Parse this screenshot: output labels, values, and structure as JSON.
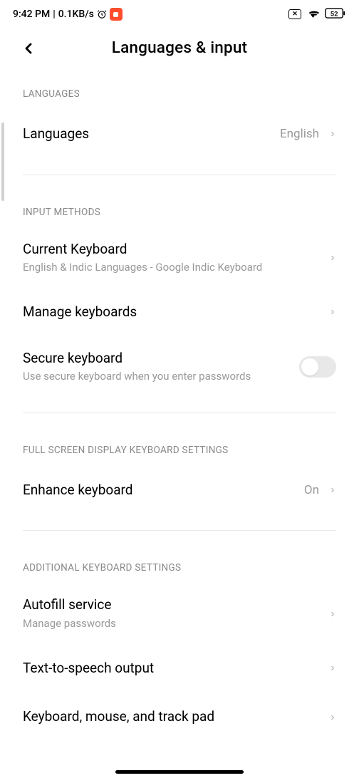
{
  "statusBar": {
    "time": "9:42 PM",
    "separator": "|",
    "dataRate": "0.1KB/s",
    "battery": "52"
  },
  "header": {
    "title": "Languages & input"
  },
  "sections": {
    "languages": {
      "header": "LANGUAGES",
      "items": {
        "languages": {
          "title": "Languages",
          "value": "English"
        }
      }
    },
    "inputMethods": {
      "header": "INPUT METHODS",
      "items": {
        "currentKeyboard": {
          "title": "Current Keyboard",
          "subtitle": "English & Indic Languages - Google Indic Keyboard"
        },
        "manageKeyboards": {
          "title": "Manage keyboards"
        },
        "secureKeyboard": {
          "title": "Secure keyboard",
          "subtitle": "Use secure keyboard when you enter passwords",
          "toggle": false
        }
      }
    },
    "fullscreen": {
      "header": "FULL SCREEN DISPLAY KEYBOARD SETTINGS",
      "items": {
        "enhanceKeyboard": {
          "title": "Enhance keyboard",
          "value": "On"
        }
      }
    },
    "additional": {
      "header": "ADDITIONAL KEYBOARD SETTINGS",
      "items": {
        "autofill": {
          "title": "Autofill service",
          "subtitle": "Manage passwords"
        },
        "tts": {
          "title": "Text-to-speech output"
        },
        "kmt": {
          "title": "Keyboard, mouse, and track pad"
        }
      }
    }
  }
}
